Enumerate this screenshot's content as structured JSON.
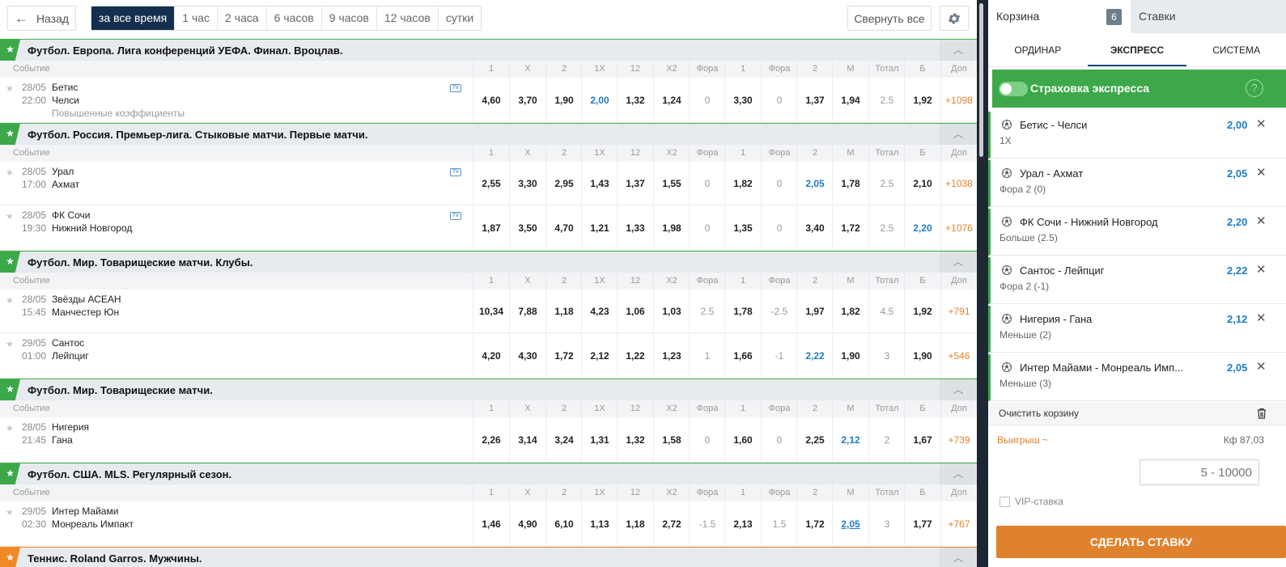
{
  "toolbar": {
    "back_label": "Назад",
    "time_filters": [
      {
        "label": "за все время",
        "active": true
      },
      {
        "label": "1 час",
        "active": false
      },
      {
        "label": "2 часа",
        "active": false
      },
      {
        "label": "6 часов",
        "active": false
      },
      {
        "label": "9 часов",
        "active": false
      },
      {
        "label": "12 часов",
        "active": false
      },
      {
        "label": "сутки",
        "active": false
      }
    ],
    "collapse_all_label": "Свернуть все",
    "settings_icon": "gear-icon"
  },
  "columns": [
    "1",
    "X",
    "2",
    "1X",
    "12",
    "X2",
    "Фора",
    "1",
    "Фора",
    "2",
    "М",
    "Тотал",
    "Б",
    "Доп"
  ],
  "event_label": "Событие",
  "sections": [
    {
      "title": "Футбол. Европа. Лига конференций УЕФА. Финал. Вроцлав.",
      "sport": "football",
      "events": [
        {
          "date": "28/05",
          "time": "22:00",
          "team1": "Бетис",
          "team2": "Челси",
          "note": "Повышенные коэффициенты",
          "tv": true,
          "odds": [
            "4,60",
            "3,70",
            "1,90",
            "2,00",
            "1,32",
            "1,24",
            "0",
            "3,30",
            "0",
            "1,37",
            "1,94",
            "2.5",
            "1,92",
            "+1098"
          ],
          "selected": 3
        }
      ]
    },
    {
      "title": "Футбол. Россия. Премьер-лига. Стыковые матчи. Первые матчи.",
      "sport": "football",
      "events": [
        {
          "date": "28/05",
          "time": "17:00",
          "team1": "Урал",
          "team2": "Ахмат",
          "tv": true,
          "odds": [
            "2,55",
            "3,30",
            "2,95",
            "1,43",
            "1,37",
            "1,55",
            "0",
            "1,82",
            "0",
            "2,05",
            "1,78",
            "2.5",
            "2,10",
            "+1038"
          ],
          "selected": 9
        },
        {
          "date": "28/05",
          "time": "19:30",
          "team1": "ФК Сочи",
          "team2": "Нижний Новгород",
          "tv": true,
          "odds": [
            "1,87",
            "3,50",
            "4,70",
            "1,21",
            "1,33",
            "1,98",
            "0",
            "1,35",
            "0",
            "3,40",
            "1,72",
            "2.5",
            "2,20",
            "+1076"
          ],
          "selected": 12
        }
      ]
    },
    {
      "title": "Футбол. Мир. Товарищеские матчи. Клубы.",
      "sport": "football",
      "events": [
        {
          "date": "28/05",
          "time": "15:45",
          "team1": "Звёзды АСЕАН",
          "team2": "Манчестер Юн",
          "tv": false,
          "odds": [
            "10,34",
            "7,88",
            "1,18",
            "4,23",
            "1,06",
            "1,03",
            "2.5",
            "1,78",
            "-2.5",
            "1,97",
            "1,82",
            "4.5",
            "1,92",
            "+791"
          ],
          "selected": -1
        },
        {
          "date": "29/05",
          "time": "01:00",
          "team1": "Сантос",
          "team2": "Лейпциг",
          "tv": false,
          "odds": [
            "4,20",
            "4,30",
            "1,72",
            "2,12",
            "1,22",
            "1,23",
            "1",
            "1,66",
            "-1",
            "2,22",
            "1,90",
            "3",
            "1,90",
            "+546"
          ],
          "selected": 9
        }
      ]
    },
    {
      "title": "Футбол. Мир. Товарищеские матчи.",
      "sport": "football",
      "events": [
        {
          "date": "28/05",
          "time": "21:45",
          "team1": "Нигерия",
          "team2": "Гана",
          "tv": false,
          "odds": [
            "2,26",
            "3,14",
            "3,24",
            "1,31",
            "1,32",
            "1,58",
            "0",
            "1,60",
            "0",
            "2,25",
            "2,12",
            "2",
            "1,67",
            "+739"
          ],
          "selected": 10
        }
      ]
    },
    {
      "title": "Футбол. США. MLS. Регулярный сезон.",
      "sport": "football",
      "events": [
        {
          "date": "29/05",
          "time": "02:30",
          "team1": "Интер Майами",
          "team2": "Монреаль Импакт",
          "tv": false,
          "odds": [
            "1,46",
            "4,90",
            "6,10",
            "1,13",
            "1,18",
            "2,72",
            "-1.5",
            "2,13",
            "1.5",
            "1,72",
            "2,05",
            "3",
            "1,77",
            "+767"
          ],
          "selected": 10,
          "selected_underline": true
        }
      ]
    },
    {
      "title": "Теннис. Roland Garros. Мужчины.",
      "sport": "tennis",
      "events": []
    }
  ],
  "cart": {
    "tab_cart_label": "Корзина",
    "cart_count": "6",
    "tab_bets_label": "Ставки",
    "bet_types": [
      {
        "label": "ОРДИНАР",
        "active": false
      },
      {
        "label": "ЭКСПРЕСС",
        "active": true
      },
      {
        "label": "СИСТЕМА",
        "active": false
      }
    ],
    "insurance_label": "Страховка экспресса",
    "insurance_help": "?",
    "items": [
      {
        "title": "Бетис - Челси",
        "market": "1X",
        "odd": "2,00"
      },
      {
        "title": "Урал - Ахмат",
        "market": "Фора 2 (0)",
        "odd": "2,05"
      },
      {
        "title": "ФК Сочи - Нижний Новгород",
        "market": "Больше (2.5)",
        "odd": "2,20"
      },
      {
        "title": "Сантос - Лейпциг",
        "market": "Фора 2 (-1)",
        "odd": "2,22"
      },
      {
        "title": "Нигерия - Гана",
        "market": "Меньше (2)",
        "odd": "2,12"
      },
      {
        "title": "Интер Майами - Монреаль Имп...",
        "market": "Меньше (3)",
        "odd": "2,05"
      }
    ],
    "clear_label": "Очистить корзину",
    "win_label": "Выигрыш ~",
    "kf_label": "Кф 87,03",
    "sum_placeholder": "5 - 10000",
    "vip_label": "VIP-ставка",
    "make_bet_label": "СДЕЛАТЬ СТАВКУ"
  },
  "colors": {
    "accent_green": "#3da84a",
    "accent_orange": "#e0822d",
    "active_blue": "#15304e",
    "odd_selected": "#1f7bc4"
  }
}
